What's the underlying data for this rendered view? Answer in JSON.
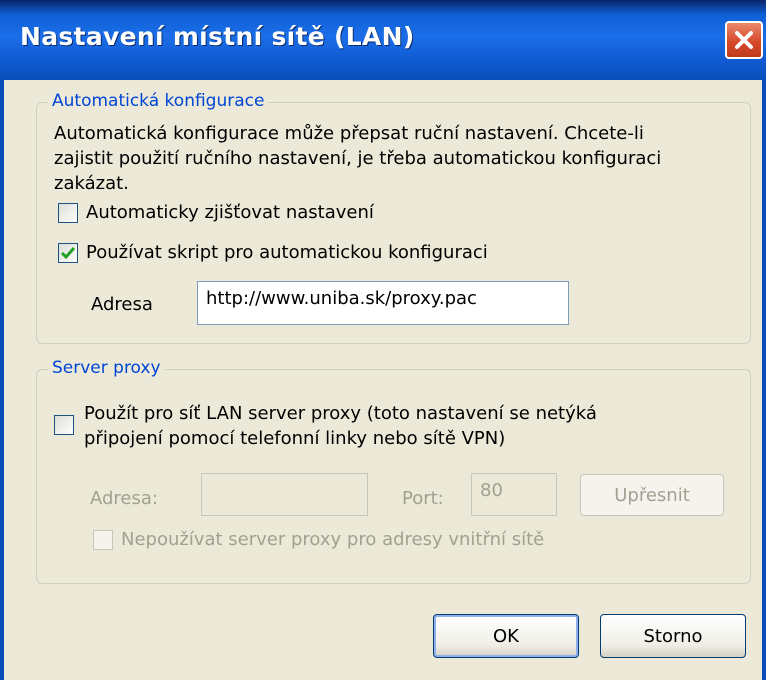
{
  "window": {
    "title": "Nastavení místní sítě (LAN)"
  },
  "auto_config": {
    "legend": "Automatická konfigurace",
    "description_lines": [
      "Automatická konfigurace může přepsat ruční nastavení. Chcete-li",
      "zajistit použití ručního nastavení, je třeba automatickou konfiguraci",
      "zakázat."
    ],
    "auto_detect": {
      "label": "Automaticky zjišťovat nastavení",
      "checked": false
    },
    "use_script": {
      "label": "Používat skript pro automatickou konfiguraci",
      "checked": true
    },
    "address_label": "Adresa",
    "address_value": "http://www.uniba.sk/proxy.pac"
  },
  "proxy": {
    "legend": "Server proxy",
    "use_proxy": {
      "label_lines": [
        "Použít pro síť LAN server proxy (toto nastavení se netýká",
        "připojení pomocí telefonní linky nebo sítě VPN)"
      ],
      "checked": false
    },
    "address_label": "Adresa:",
    "address_value": "",
    "port_label": "Port:",
    "port_value": "80",
    "advanced_label": "Upřesnit",
    "bypass": {
      "label": "Nepoužívat server proxy pro adresy vnitřní sítě",
      "checked": false
    }
  },
  "buttons": {
    "ok": "OK",
    "cancel": "Storno"
  },
  "colors": {
    "titlebar": "#0e58cf",
    "legend": "#0046d5",
    "close": "#d6492b",
    "dialog_bg": "#ece9d8"
  }
}
